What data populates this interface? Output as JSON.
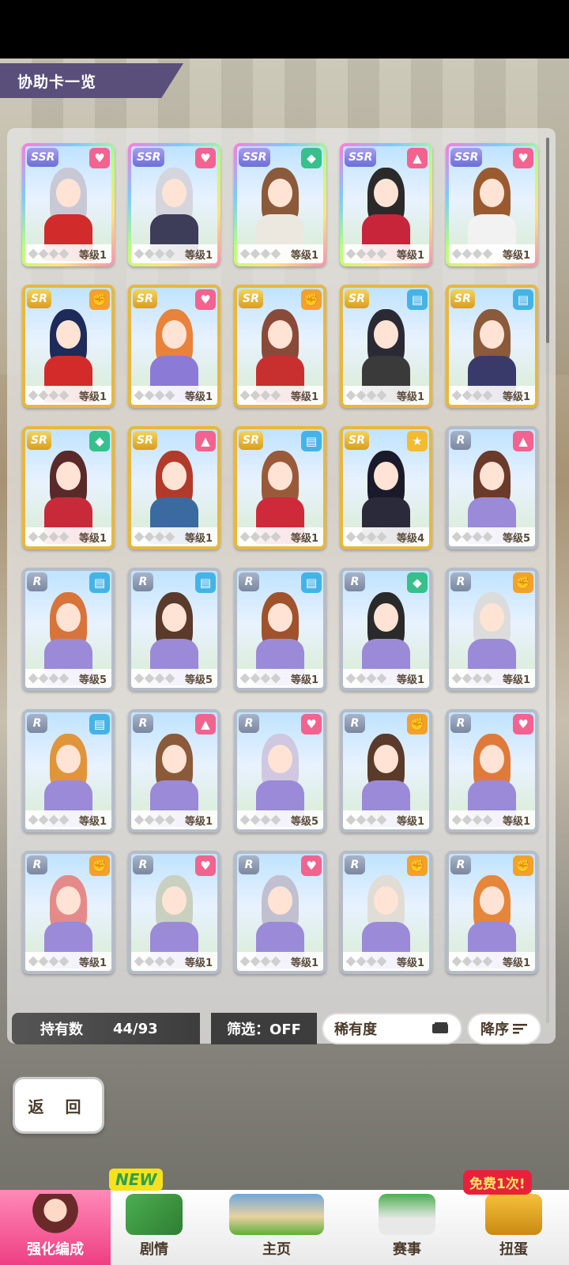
{
  "title": "协助卡一览",
  "cards": [
    {
      "rarity": "SSR",
      "type": "heart",
      "level": "等级1",
      "hair": "#c9c9d6",
      "outfit": "#d12b2b"
    },
    {
      "rarity": "SSR",
      "type": "heart",
      "level": "等级1",
      "hair": "#d5d5dd",
      "outfit": "#3d3d5a"
    },
    {
      "rarity": "SSR",
      "type": "int",
      "level": "等级1",
      "hair": "#8a5a3a",
      "outfit": "#ece8e0"
    },
    {
      "rarity": "SSR",
      "type": "guts",
      "level": "等级1",
      "hair": "#2a2a2a",
      "outfit": "#c8243a"
    },
    {
      "rarity": "SSR",
      "type": "heart",
      "level": "等级1",
      "hair": "#9a5a30",
      "outfit": "#f2f2f2"
    },
    {
      "rarity": "SR",
      "type": "power",
      "level": "等级1",
      "hair": "#1d2a5a",
      "outfit": "#d32a2a"
    },
    {
      "rarity": "SR",
      "type": "heart",
      "level": "等级1",
      "hair": "#e9823a",
      "outfit": "#8b7ad6"
    },
    {
      "rarity": "SR",
      "type": "power",
      "level": "等级1",
      "hair": "#8a4a3a",
      "outfit": "#c83030"
    },
    {
      "rarity": "SR",
      "type": "wit",
      "level": "等级1",
      "hair": "#2a2a35",
      "outfit": "#3a3a3a"
    },
    {
      "rarity": "SR",
      "type": "wit",
      "level": "等级1",
      "hair": "#8a5a3a",
      "outfit": "#3a3a6a"
    },
    {
      "rarity": "SR",
      "type": "int",
      "level": "等级1",
      "hair": "#5a2a2a",
      "outfit": "#c82a3a"
    },
    {
      "rarity": "SR",
      "type": "guts",
      "level": "等级1",
      "hair": "#b23a2a",
      "outfit": "#3a6aa0"
    },
    {
      "rarity": "SR",
      "type": "wit",
      "level": "等级1",
      "hair": "#9a5a3a",
      "outfit": "#cf2a3a"
    },
    {
      "rarity": "SR",
      "type": "friend",
      "level": "等级4",
      "hair": "#1a1a2a",
      "outfit": "#2a2a3a"
    },
    {
      "rarity": "R",
      "type": "guts",
      "level": "等级5",
      "hair": "#6a3a2a",
      "outfit": "#9a8ad8"
    },
    {
      "rarity": "R",
      "type": "wit",
      "level": "等级5",
      "hair": "#d8743a",
      "outfit": "#9a8ad8"
    },
    {
      "rarity": "R",
      "type": "wit",
      "level": "等级5",
      "hair": "#5a3a2a",
      "outfit": "#9a8ad8"
    },
    {
      "rarity": "R",
      "type": "wit",
      "level": "等级1",
      "hair": "#a0522d",
      "outfit": "#9a8ad8"
    },
    {
      "rarity": "R",
      "type": "int",
      "level": "等级1",
      "hair": "#2a2a2a",
      "outfit": "#9a8ad8"
    },
    {
      "rarity": "R",
      "type": "power",
      "level": "等级1",
      "hair": "#dcdcdc",
      "outfit": "#9a8ad8"
    },
    {
      "rarity": "R",
      "type": "wit",
      "level": "等级1",
      "hair": "#e0953a",
      "outfit": "#9a8ad8"
    },
    {
      "rarity": "R",
      "type": "guts",
      "level": "等级1",
      "hair": "#8a5a3a",
      "outfit": "#9a8ad8"
    },
    {
      "rarity": "R",
      "type": "heart",
      "level": "等级5",
      "hair": "#cfc8e0",
      "outfit": "#9a8ad8"
    },
    {
      "rarity": "R",
      "type": "power",
      "level": "等级1",
      "hair": "#5a3a2a",
      "outfit": "#9a8ad8"
    },
    {
      "rarity": "R",
      "type": "heart",
      "level": "等级1",
      "hair": "#e07a3a",
      "outfit": "#9a8ad8"
    },
    {
      "rarity": "R",
      "type": "power",
      "level": "等级1",
      "hair": "#e58a8a",
      "outfit": "#9a8ad8"
    },
    {
      "rarity": "R",
      "type": "heart",
      "level": "等级1",
      "hair": "#c9d0c0",
      "outfit": "#9a8ad8"
    },
    {
      "rarity": "R",
      "type": "heart",
      "level": "等级1",
      "hair": "#c0c0d0",
      "outfit": "#9a8ad8"
    },
    {
      "rarity": "R",
      "type": "power",
      "level": "等级1",
      "hair": "#e0dcd6",
      "outfit": "#9a8ad8"
    },
    {
      "rarity": "R",
      "type": "power",
      "level": "等级1",
      "hair": "#e5863a",
      "outfit": "#9a8ad8"
    }
  ],
  "filter_bar": {
    "own_label": "持有数",
    "own_count": "44/93",
    "filter_label": "筛选：OFF",
    "sort_label": "稀有度",
    "order_label": "降序"
  },
  "back_label": "返 回",
  "nav": {
    "items": [
      {
        "label": "强化编成",
        "active": true
      },
      {
        "label": "剧情"
      },
      {
        "label": "主页"
      },
      {
        "label": "赛事"
      },
      {
        "label": "扭蛋"
      }
    ],
    "new_badge": "NEW",
    "free_badge": "免费1次!"
  },
  "colors": {
    "accent": "#ee3f83",
    "title_bg": "#5a4f7a"
  }
}
